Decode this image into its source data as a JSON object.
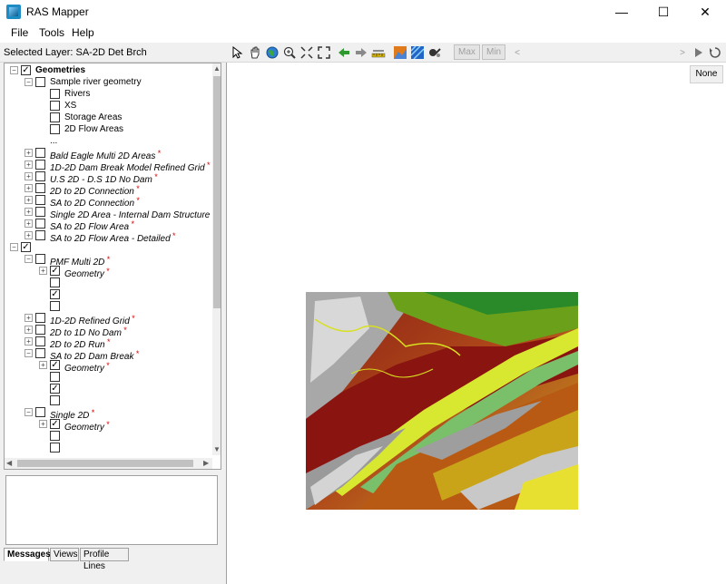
{
  "window": {
    "title": "RAS Mapper",
    "minimize": "—",
    "maximize": "☐",
    "close": "✕"
  },
  "menu": [
    "File",
    "Tools",
    "Help"
  ],
  "toolbar": {
    "selected_layer": "Selected Layer: SA-2D Det Brch",
    "max_label": "Max",
    "min_label": "Min",
    "icons": [
      "pointer-icon",
      "pan-icon",
      "globe-icon",
      "zoom-in-icon",
      "zoom-full-extent-icon",
      "zoom-layer-icon",
      "back-arrow-icon",
      "forward-arrow-icon",
      "measure-icon",
      "terrain-icon",
      "layer-style-icon",
      "profile-icon"
    ]
  },
  "tree": [
    {
      "indent": 0,
      "expander": "-",
      "checked": true,
      "label": "Geometries",
      "bold": true,
      "italic": false,
      "star": false
    },
    {
      "indent": 1,
      "expander": "-",
      "checked": false,
      "label": "Sample river geometry",
      "bold": false,
      "italic": false,
      "star": false
    },
    {
      "indent": 2,
      "expander": "",
      "checked": false,
      "label": "Rivers",
      "bold": false,
      "italic": false,
      "star": false
    },
    {
      "indent": 2,
      "expander": "",
      "checked": false,
      "label": "XS",
      "bold": false,
      "italic": false,
      "star": false
    },
    {
      "indent": 2,
      "expander": "",
      "checked": false,
      "label": "Storage Areas",
      "bold": false,
      "italic": false,
      "star": false
    },
    {
      "indent": 2,
      "expander": "",
      "checked": false,
      "label": "2D Flow Areas",
      "bold": false,
      "italic": false,
      "star": false
    },
    {
      "indent": 2,
      "expander": "",
      "checked": null,
      "label": "...",
      "bold": false,
      "italic": false,
      "star": false
    },
    {
      "indent": 1,
      "expander": "+",
      "checked": false,
      "label": "Bald Eagle Multi 2D Areas",
      "bold": false,
      "italic": true,
      "star": true
    },
    {
      "indent": 1,
      "expander": "+",
      "checked": false,
      "label": "1D-2D Dam Break Model Refined Grid",
      "bold": false,
      "italic": true,
      "star": true
    },
    {
      "indent": 1,
      "expander": "+",
      "checked": false,
      "label": "U.S 2D - D.S 1D No Dam",
      "bold": false,
      "italic": true,
      "star": true
    },
    {
      "indent": 1,
      "expander": "+",
      "checked": false,
      "label": "2D to 2D Connection",
      "bold": false,
      "italic": true,
      "star": true
    },
    {
      "indent": 1,
      "expander": "+",
      "checked": false,
      "label": "SA to 2D Connection",
      "bold": false,
      "italic": true,
      "star": true
    },
    {
      "indent": 1,
      "expander": "+",
      "checked": false,
      "label": "Single 2D Area - Internal Dam Structure",
      "bold": false,
      "italic": true,
      "star": true
    },
    {
      "indent": 1,
      "expander": "+",
      "checked": false,
      "label": "SA to 2D Flow Area",
      "bold": false,
      "italic": true,
      "star": true
    },
    {
      "indent": 1,
      "expander": "+",
      "checked": false,
      "label": "SA to 2D Flow Area - Detailed",
      "bold": false,
      "italic": true,
      "star": true
    },
    {
      "indent": 0,
      "expander": "-",
      "checked": true,
      "label": "",
      "bold": false,
      "italic": false,
      "star": false
    },
    {
      "indent": 1,
      "expander": "-",
      "checked": false,
      "label": "PMF Multi 2D",
      "bold": false,
      "italic": true,
      "star": true
    },
    {
      "indent": 2,
      "expander": "+",
      "checked": true,
      "label": "Geometry",
      "bold": false,
      "italic": true,
      "star": true
    },
    {
      "indent": 2,
      "expander": "",
      "checked": false,
      "label": "",
      "bold": false,
      "italic": false,
      "star": false
    },
    {
      "indent": 2,
      "expander": "",
      "checked": true,
      "label": "",
      "bold": false,
      "italic": false,
      "star": false
    },
    {
      "indent": 2,
      "expander": "",
      "checked": false,
      "label": "",
      "bold": false,
      "italic": false,
      "star": false
    },
    {
      "indent": 1,
      "expander": "+",
      "checked": false,
      "label": "1D-2D Refined Grid",
      "bold": false,
      "italic": true,
      "star": true
    },
    {
      "indent": 1,
      "expander": "+",
      "checked": false,
      "label": "2D to 1D No Dam",
      "bold": false,
      "italic": true,
      "star": true
    },
    {
      "indent": 1,
      "expander": "+",
      "checked": false,
      "label": "2D to 2D Run",
      "bold": false,
      "italic": true,
      "star": true
    },
    {
      "indent": 1,
      "expander": "-",
      "checked": false,
      "label": "SA to 2D Dam Break",
      "bold": false,
      "italic": true,
      "star": true
    },
    {
      "indent": 2,
      "expander": "+",
      "checked": true,
      "label": "Geometry",
      "bold": false,
      "italic": true,
      "star": true
    },
    {
      "indent": 2,
      "expander": "",
      "checked": false,
      "label": "",
      "bold": false,
      "italic": false,
      "star": false
    },
    {
      "indent": 2,
      "expander": "",
      "checked": true,
      "label": "",
      "bold": false,
      "italic": false,
      "star": false
    },
    {
      "indent": 2,
      "expander": "",
      "checked": false,
      "label": "",
      "bold": false,
      "italic": false,
      "star": false
    },
    {
      "indent": 1,
      "expander": "-",
      "checked": false,
      "label": "Single 2D",
      "bold": false,
      "italic": true,
      "star": true
    },
    {
      "indent": 2,
      "expander": "+",
      "checked": true,
      "label": "Geometry",
      "bold": false,
      "italic": true,
      "star": true
    },
    {
      "indent": 2,
      "expander": "",
      "checked": false,
      "label": "",
      "bold": false,
      "italic": false,
      "star": false
    },
    {
      "indent": 2,
      "expander": "",
      "checked": false,
      "label": "",
      "bold": false,
      "italic": false,
      "star": false
    }
  ],
  "tabs": [
    "Messages",
    "Views",
    "Profile Lines"
  ],
  "map": {
    "none_button": "None"
  }
}
